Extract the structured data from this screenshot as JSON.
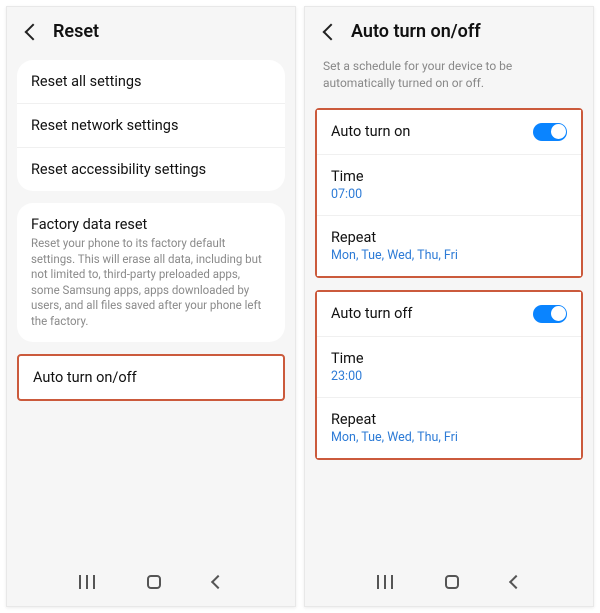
{
  "left": {
    "title": "Reset",
    "group1": [
      "Reset all settings",
      "Reset network settings",
      "Reset accessibility settings"
    ],
    "factory": {
      "title": "Factory data reset",
      "desc": "Reset your phone to its factory default settings. This will erase all data, including but not limited to, third-party preloaded apps, some Samsung apps, apps downloaded by users, and all files saved after your phone left the factory."
    },
    "auto": "Auto turn on/off"
  },
  "right": {
    "title": "Auto turn on/off",
    "subtitle": "Set a schedule for your device to be automatically turned on or off.",
    "on": {
      "label": "Auto turn on",
      "timeLabel": "Time",
      "time": "07:00",
      "repeatLabel": "Repeat",
      "repeat": "Mon, Tue, Wed, Thu, Fri"
    },
    "off": {
      "label": "Auto turn off",
      "timeLabel": "Time",
      "time": "23:00",
      "repeatLabel": "Repeat",
      "repeat": "Mon, Tue, Wed, Thu, Fri"
    }
  }
}
